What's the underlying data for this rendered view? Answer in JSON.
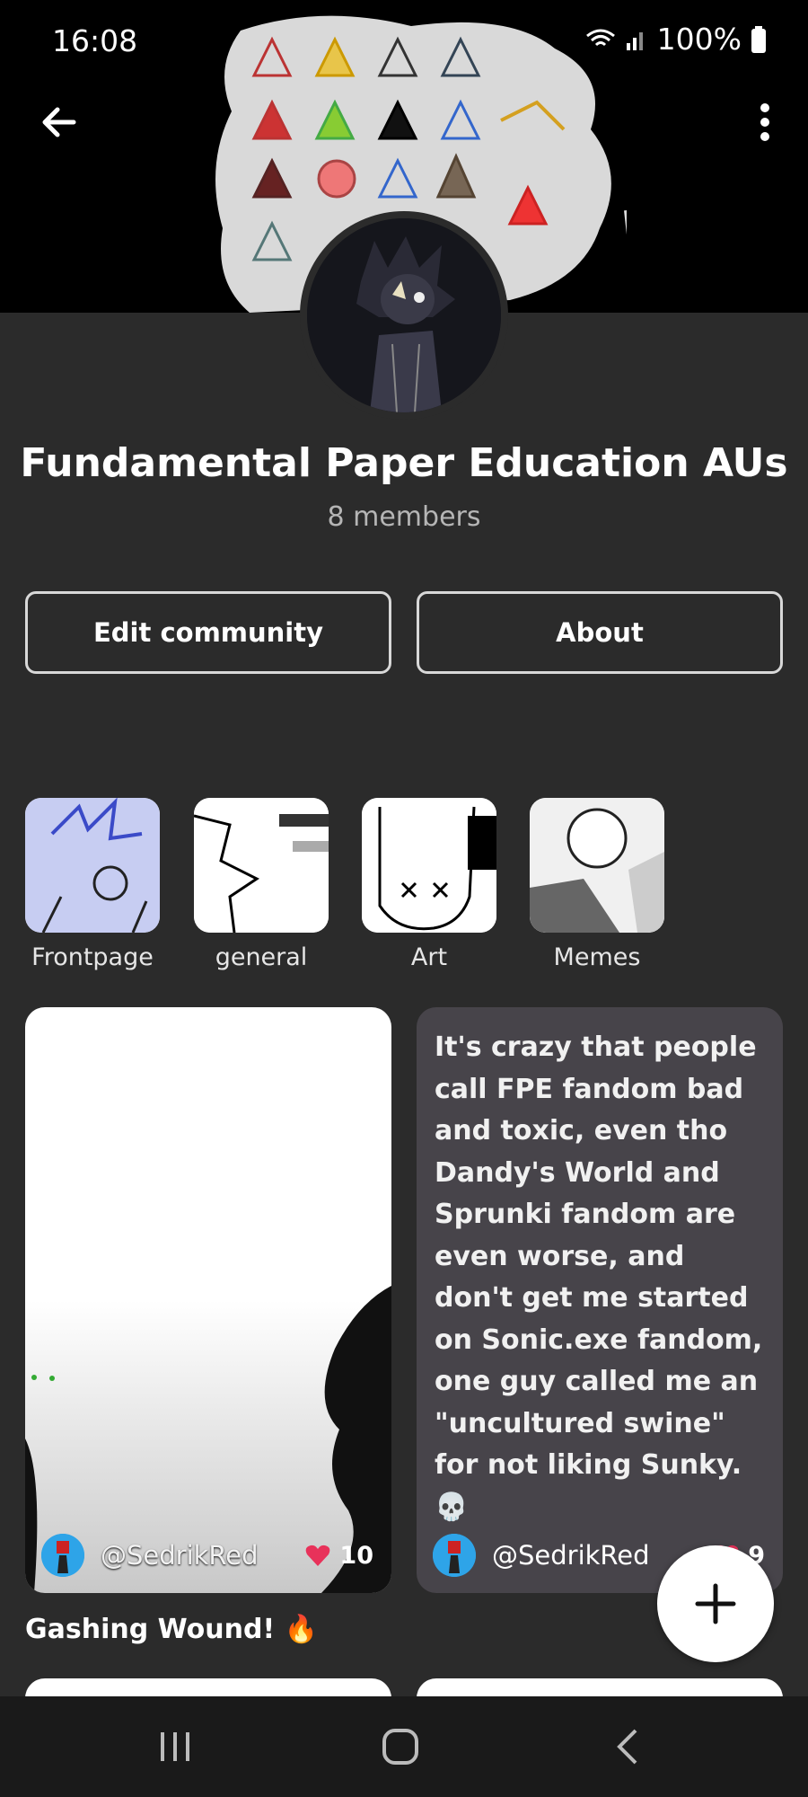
{
  "status": {
    "time": "16:08",
    "battery": "100%"
  },
  "community": {
    "title": "Fundamental Paper Education AUs",
    "members": "8 members"
  },
  "actions": {
    "edit_label": "Edit community",
    "about_label": "About"
  },
  "categories": [
    {
      "label": "Frontpage"
    },
    {
      "label": "general"
    },
    {
      "label": "Art"
    },
    {
      "label": "Memes"
    }
  ],
  "posts": [
    {
      "user": "@SedrikRed",
      "likes": "10",
      "title": "Gashing Wound! 🔥"
    },
    {
      "user": "@SedrikRed",
      "likes": "9",
      "body": "It's crazy that people call FPE fandom bad and toxic, even tho Dandy's World and Sprunki fandom are even worse, and don't get me started on Sonic.exe fandom, one guy called me an \"uncultured swine\" for not liking Sunky. 💀"
    }
  ],
  "colors": {
    "background": "#2b2b2b",
    "card_text_bg": "#47444a",
    "like_heart": "#e8325a",
    "avatar_blue": "#2ea4e8"
  },
  "icons": [
    "back-arrow-icon",
    "more-vert-icon",
    "heart-icon",
    "plus-icon",
    "recents-icon",
    "home-icon",
    "back-nav-icon"
  ]
}
